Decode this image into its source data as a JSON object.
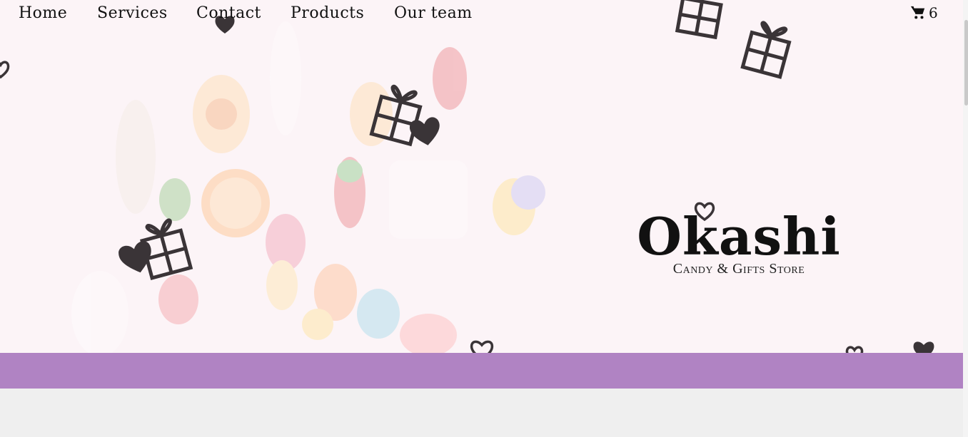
{
  "nav": {
    "items": [
      {
        "label": "Home"
      },
      {
        "label": "Services"
      },
      {
        "label": "Contact"
      },
      {
        "label": "Products"
      },
      {
        "label": "Our team"
      }
    ],
    "cart_icon": "shopping-cart-icon",
    "cart_count": "6"
  },
  "hero": {
    "title": "Okashi",
    "subtitle": "Candy & Gifts Store",
    "decor_icons": [
      "gift-icon",
      "heart-icon"
    ]
  },
  "colors": {
    "band": "#b083c3",
    "hero_background": "#fcf4f7",
    "page_background": "#efefef",
    "icon_dark": "#3a3437"
  }
}
